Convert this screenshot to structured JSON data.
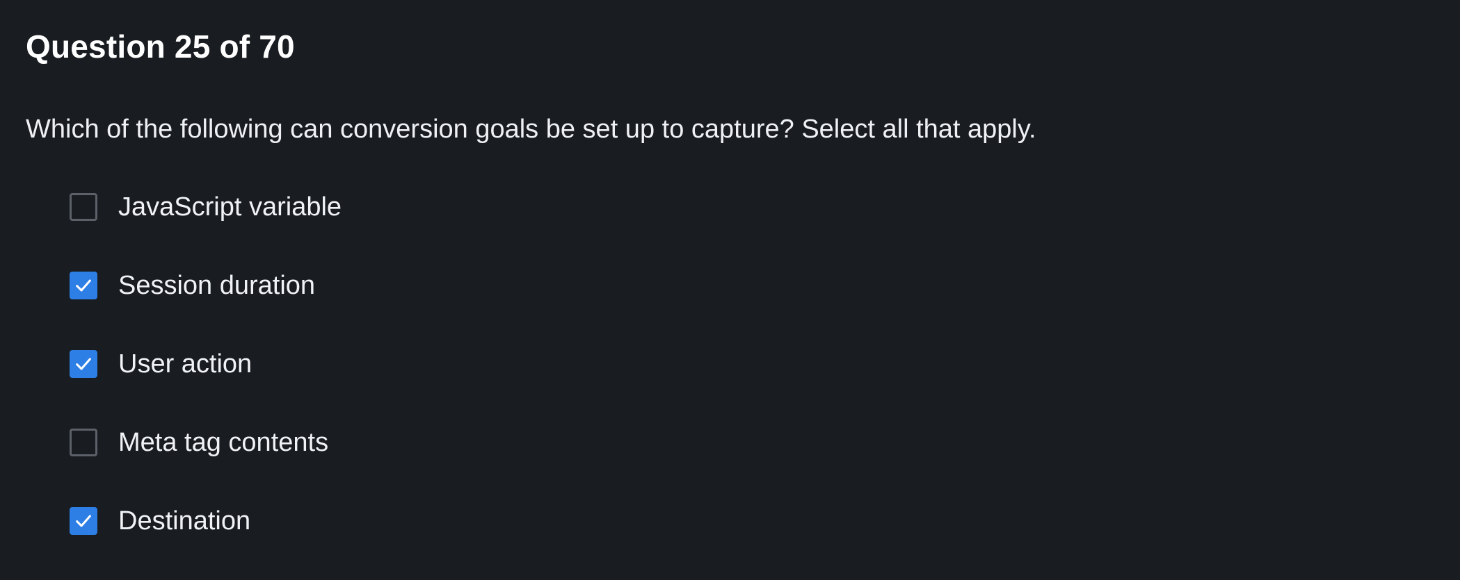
{
  "question": {
    "header": "Question 25 of 70",
    "text": "Which of the following can conversion goals be set up to capture? Select all that apply."
  },
  "options": [
    {
      "label": "JavaScript variable",
      "checked": false
    },
    {
      "label": "Session duration",
      "checked": true
    },
    {
      "label": "User action",
      "checked": true
    },
    {
      "label": "Meta tag contents",
      "checked": false
    },
    {
      "label": "Destination",
      "checked": true
    }
  ],
  "colors": {
    "background": "#191c21",
    "checkbox_checked": "#2d7fe6",
    "checkbox_border": "#5c6068",
    "text": "#f0f2f5"
  },
  "icons": {
    "checkmark": "check-icon"
  }
}
